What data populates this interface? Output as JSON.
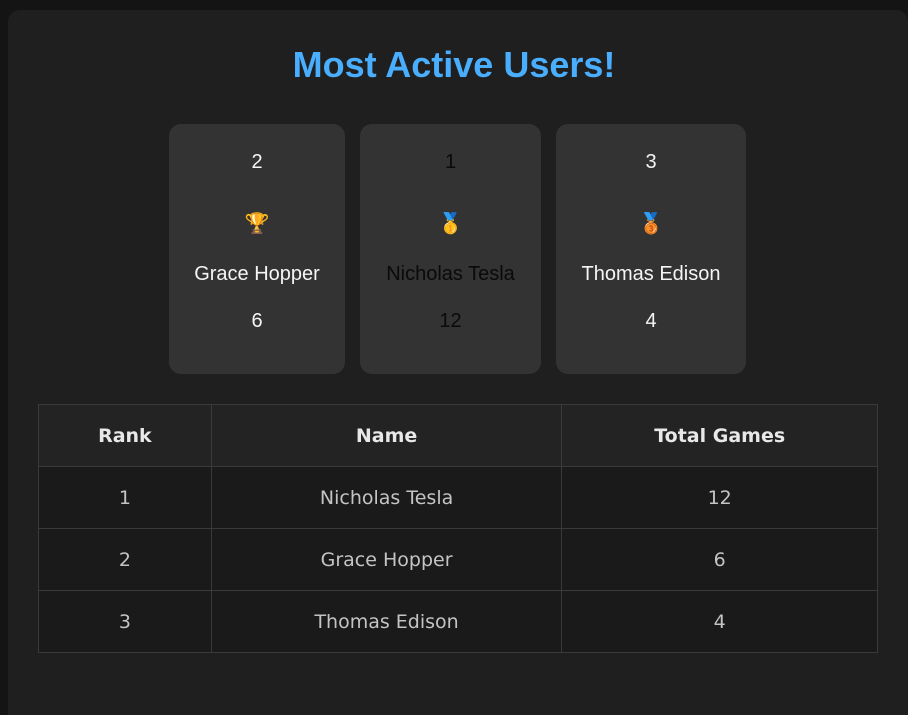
{
  "page": {
    "title": "Most Active Users!"
  },
  "podium": [
    {
      "rank": "2",
      "medal": "🏆",
      "medal_icon": "trophy-icon",
      "name": "Grace Hopper",
      "games": "6"
    },
    {
      "rank": "1",
      "medal": "🥇",
      "medal_icon": "gold-medal-icon",
      "name": "Nicholas Tesla",
      "games": "12"
    },
    {
      "rank": "3",
      "medal": "🥉",
      "medal_icon": "bronze-medal-icon",
      "name": "Thomas Edison",
      "games": "4"
    }
  ],
  "table": {
    "headers": [
      "Rank",
      "Name",
      "Total Games"
    ],
    "rows": [
      [
        "1",
        "Nicholas Tesla",
        "12"
      ],
      [
        "2",
        "Grace Hopper",
        "6"
      ],
      [
        "3",
        "Thomas Edison",
        "4"
      ]
    ]
  },
  "colors": {
    "title": "#4aaeff",
    "background": "#1f1f1f",
    "card": "#333333"
  }
}
